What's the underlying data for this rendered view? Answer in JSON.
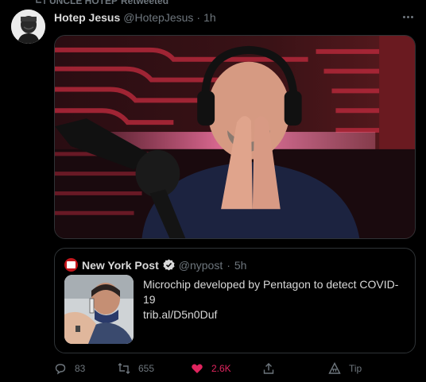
{
  "retweet_banner": {
    "name": "UNCLE HOTEP",
    "action": "Retweeted"
  },
  "tweet": {
    "author_name": "Hotep Jesus",
    "author_handle": "@HotepJesus",
    "separator": "·",
    "timestamp": "1h"
  },
  "quoted_tweet": {
    "author_name": "New York Post",
    "author_handle": "@nypost",
    "separator": "·",
    "timestamp": "5h",
    "text_line1": "Microchip developed by Pentagon to detect COVID-19",
    "text_line2": "trib.al/D5n0Duf"
  },
  "actions": {
    "reply_count": "83",
    "retweet_count": "655",
    "like_count": "2.6K",
    "tip_label": "Tip"
  },
  "colors": {
    "background": "#000000",
    "text_primary": "#d9d9d9",
    "text_secondary": "#6e767d",
    "border": "#2f3336",
    "like_active": "#e0245e",
    "verified": "#d9d9d9",
    "nyp_brand": "#c4161c"
  }
}
